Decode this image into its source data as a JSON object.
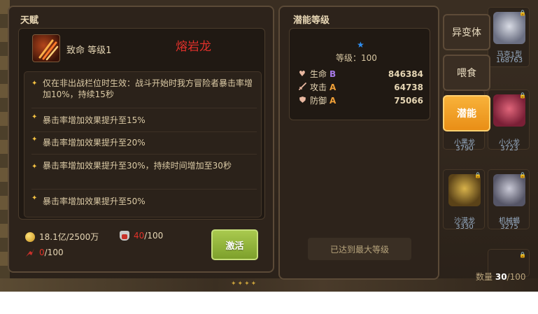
{
  "talent": {
    "title": "天赋",
    "skill_name": "致命 等级1",
    "dragon_name": "熔岩龙",
    "effects": [
      "仅在非出战栏位时生效：战斗开始时我方冒险者暴击率增加10%，持续15秒",
      "暴击率增加效果提升至15%",
      "暴击率增加效果提升至20%",
      "暴击率增加效果提升至30%，持续时间增加至30秒",
      "暴击率增加效果提升至50%"
    ],
    "resources": {
      "gold": "18.1亿/2500万",
      "potion_current": "40",
      "potion_total": "/100",
      "shard_current": "0",
      "shard_total": "/100"
    },
    "activate_label": "激活"
  },
  "potential": {
    "title": "潜能等级",
    "level_text": "等级：100",
    "stats": [
      {
        "name": "生命",
        "grade": "B",
        "grade_color": "#a67ae8",
        "value": "846384",
        "icon": "heart-icon"
      },
      {
        "name": "攻击",
        "grade": "A",
        "grade_color": "#f0a038",
        "value": "64738",
        "icon": "sword-icon"
      },
      {
        "name": "防御",
        "grade": "A",
        "grade_color": "#f0a038",
        "value": "75066",
        "icon": "shield-icon"
      }
    ],
    "max_level_text": "已达到最大等级"
  },
  "tabs": [
    {
      "label": "异变体",
      "active": false
    },
    {
      "label": "喂食",
      "active": false
    },
    {
      "label": "潜能",
      "active": true
    }
  ],
  "monsters": [
    {
      "name": "马克1型",
      "value": "168763"
    },
    {
      "name": "小黑龙",
      "value": "3790"
    },
    {
      "name": "小火龙",
      "value": "3723"
    },
    {
      "name": "沙漠龙",
      "value": "3330"
    },
    {
      "name": "机械蝎",
      "value": "3275"
    }
  ],
  "collection": {
    "label": "数量",
    "current": "30",
    "total": "/100"
  },
  "colors": {
    "accent": "#f0a021",
    "activate": "#8fb43a",
    "dragon_name": "#e0302a"
  }
}
